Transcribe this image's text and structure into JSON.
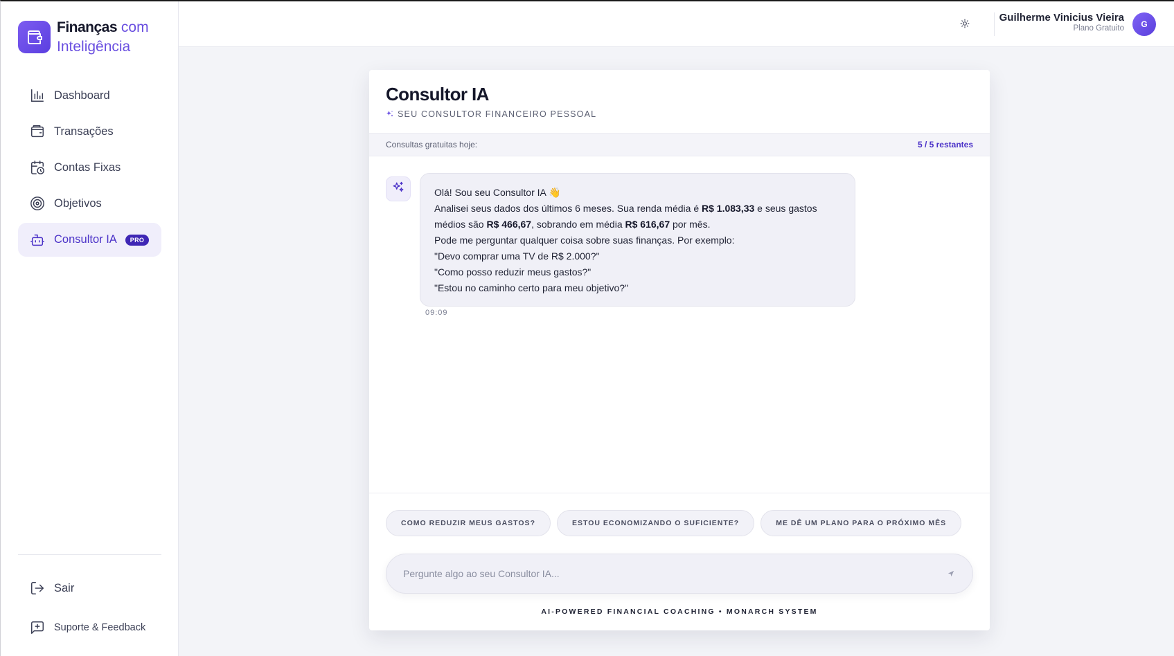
{
  "brand": {
    "name_bold": "Finanças",
    "name_light1": "com",
    "name_light2": "Inteligência"
  },
  "sidebar": {
    "items": [
      {
        "label": "Dashboard",
        "icon": "bar-chart-icon"
      },
      {
        "label": "Transações",
        "icon": "wallet-icon"
      },
      {
        "label": "Contas Fixas",
        "icon": "calendar-clock-icon"
      },
      {
        "label": "Objetivos",
        "icon": "target-icon"
      },
      {
        "label": "Consultor IA",
        "icon": "robot-icon",
        "badge": "PRO",
        "active": true
      }
    ],
    "logout_label": "Sair",
    "support_label": "Suporte & Feedback"
  },
  "topbar": {
    "user_name": "Guilherme Vinicius Vieira",
    "user_plan": "Plano Gratuito",
    "avatar_initial": "G"
  },
  "consultant": {
    "title": "Consultor IA",
    "subtitle": "SEU CONSULTOR FINANCEIRO PESSOAL",
    "quota_label": "Consultas gratuitas hoje:",
    "quota_value": "5 / 5 restantes",
    "message": {
      "greeting": "Olá! Sou seu Consultor IA 👋",
      "line1_a": "Analisei seus dados dos últimos 6 meses. Sua renda média é ",
      "income": "R$ 1.083,33",
      "line1_b": " e seus gastos médios são ",
      "expenses": "R$ 466,67",
      "line1_c": ", sobrando em média ",
      "surplus": "R$ 616,67",
      "line1_d": " por mês.",
      "line2": "Pode me perguntar qualquer coisa sobre suas finanças. Por exemplo:",
      "example1": "\"Devo comprar uma TV de R$ 2.000?\"",
      "example2": "\"Como posso reduzir meus gastos?\"",
      "example3": "\"Estou no caminho certo para meu objetivo?\"",
      "time": "09:09"
    },
    "suggestions": [
      "COMO REDUZIR MEUS GASTOS?",
      "ESTOU ECONOMIZANDO O SUFICIENTE?",
      "ME DÊ UM PLANO PARA O PRÓXIMO MÊS"
    ],
    "input_placeholder": "Pergunte algo ao seu Consultor IA...",
    "footer": "AI-POWERED FINANCIAL COACHING • MONARCH SYSTEM"
  },
  "colors": {
    "accent": "#4b32c8",
    "brand": "#6a4fe0",
    "background": "#f3f4f8"
  }
}
